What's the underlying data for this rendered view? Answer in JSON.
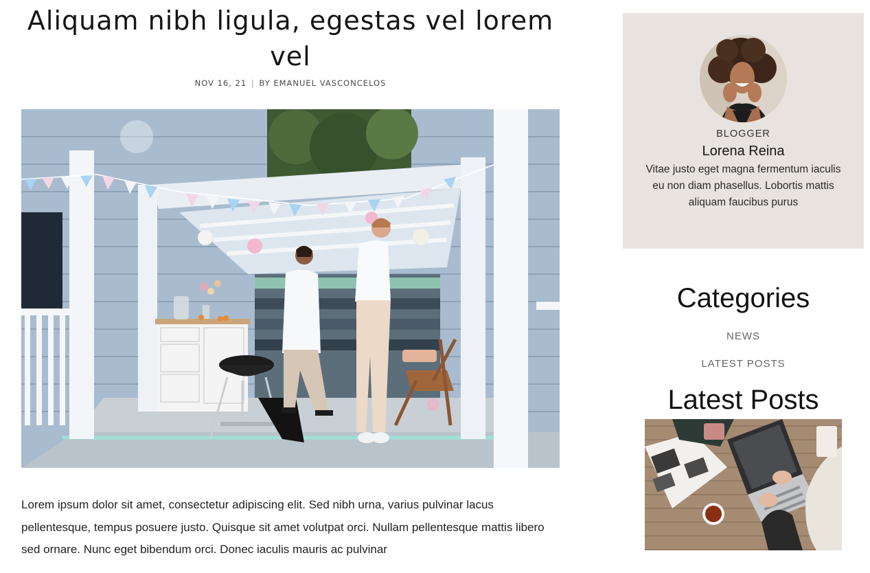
{
  "post": {
    "title": "Aliquam nibh ligula, egestas vel lorem vel",
    "date": "NOV 16, 21",
    "meta_separator": "|",
    "author": "BY EMANUEL VASCONCELOS",
    "body": "Lorem ipsum dolor sit amet, consectetur adipiscing elit. Sed nibh urna, varius pulvinar lacus pellentesque, tempus posuere justo. Quisque sit amet volutpat orci. Nullam pellentesque mattis libero sed ornare. Nunc eget bibendum orci. Donec iaculis mauris ac pulvinar"
  },
  "author_box": {
    "role": "BLOGGER",
    "name": "Lorena Reina",
    "bio": "Vitae justo eget magna fermentum iaculis eu non diam phasellus. Lobortis mattis aliquam faucibus purus",
    "background_color": "#e8e3df"
  },
  "categories": {
    "title": "Categories",
    "items": [
      "NEWS",
      "LATEST POSTS"
    ]
  },
  "latest_posts": {
    "title": "Latest Posts"
  }
}
